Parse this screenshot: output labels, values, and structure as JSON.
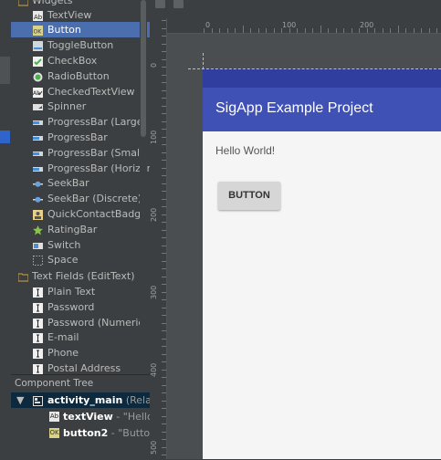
{
  "palette": {
    "header": "Widgets",
    "items": [
      {
        "label": "TextView",
        "icon": "textview-icon"
      },
      {
        "label": "Button",
        "icon": "button-icon",
        "selected": true
      },
      {
        "label": "ToggleButton",
        "icon": "togglebutton-icon"
      },
      {
        "label": "CheckBox",
        "icon": "checkbox-icon"
      },
      {
        "label": "RadioButton",
        "icon": "radiobutton-icon"
      },
      {
        "label": "CheckedTextView",
        "icon": "checkedtextview-icon"
      },
      {
        "label": "Spinner",
        "icon": "spinner-icon"
      },
      {
        "label": "ProgressBar (Large)",
        "icon": "progressbar-icon"
      },
      {
        "label": "ProgressBar",
        "icon": "progressbar-icon"
      },
      {
        "label": "ProgressBar (Small)",
        "icon": "progressbar-icon"
      },
      {
        "label": "ProgressBar (Horizont",
        "icon": "progressbar-icon"
      },
      {
        "label": "SeekBar",
        "icon": "seekbar-icon"
      },
      {
        "label": "SeekBar (Discrete)",
        "icon": "seekbar-icon"
      },
      {
        "label": "QuickContactBadge",
        "icon": "quickcontactbadge-icon"
      },
      {
        "label": "RatingBar",
        "icon": "ratingbar-icon"
      },
      {
        "label": "Switch",
        "icon": "switch-icon"
      },
      {
        "label": "Space",
        "icon": "space-icon"
      }
    ],
    "category2": "Text Fields (EditText)",
    "items2": [
      {
        "label": "Plain Text",
        "icon": "edittext-icon"
      },
      {
        "label": "Password",
        "icon": "edittext-icon"
      },
      {
        "label": "Password (Numeric)",
        "icon": "edittext-icon"
      },
      {
        "label": "E-mail",
        "icon": "edittext-icon"
      },
      {
        "label": "Phone",
        "icon": "edittext-icon"
      },
      {
        "label": "Postal Address",
        "icon": "edittext-icon"
      }
    ]
  },
  "component_tree": {
    "title": "Component Tree",
    "root": {
      "name": "activity_main",
      "type": " (Relat"
    },
    "children": [
      {
        "name": "textView",
        "value": " - \"Hello"
      },
      {
        "name": "button2",
        "value": " - \"Butto"
      }
    ]
  },
  "rulers": {
    "top": [
      "0",
      "100",
      "200"
    ],
    "left": [
      "0",
      "100",
      "200",
      "300",
      "400",
      "500"
    ]
  },
  "app": {
    "title": "SigApp Example Project",
    "hello_text": "Hello World!",
    "button_label": "BUTTON"
  },
  "colors": {
    "primary": "#3f51b5",
    "primary_dark": "#303f9f",
    "selection": "#4b6eaf"
  }
}
